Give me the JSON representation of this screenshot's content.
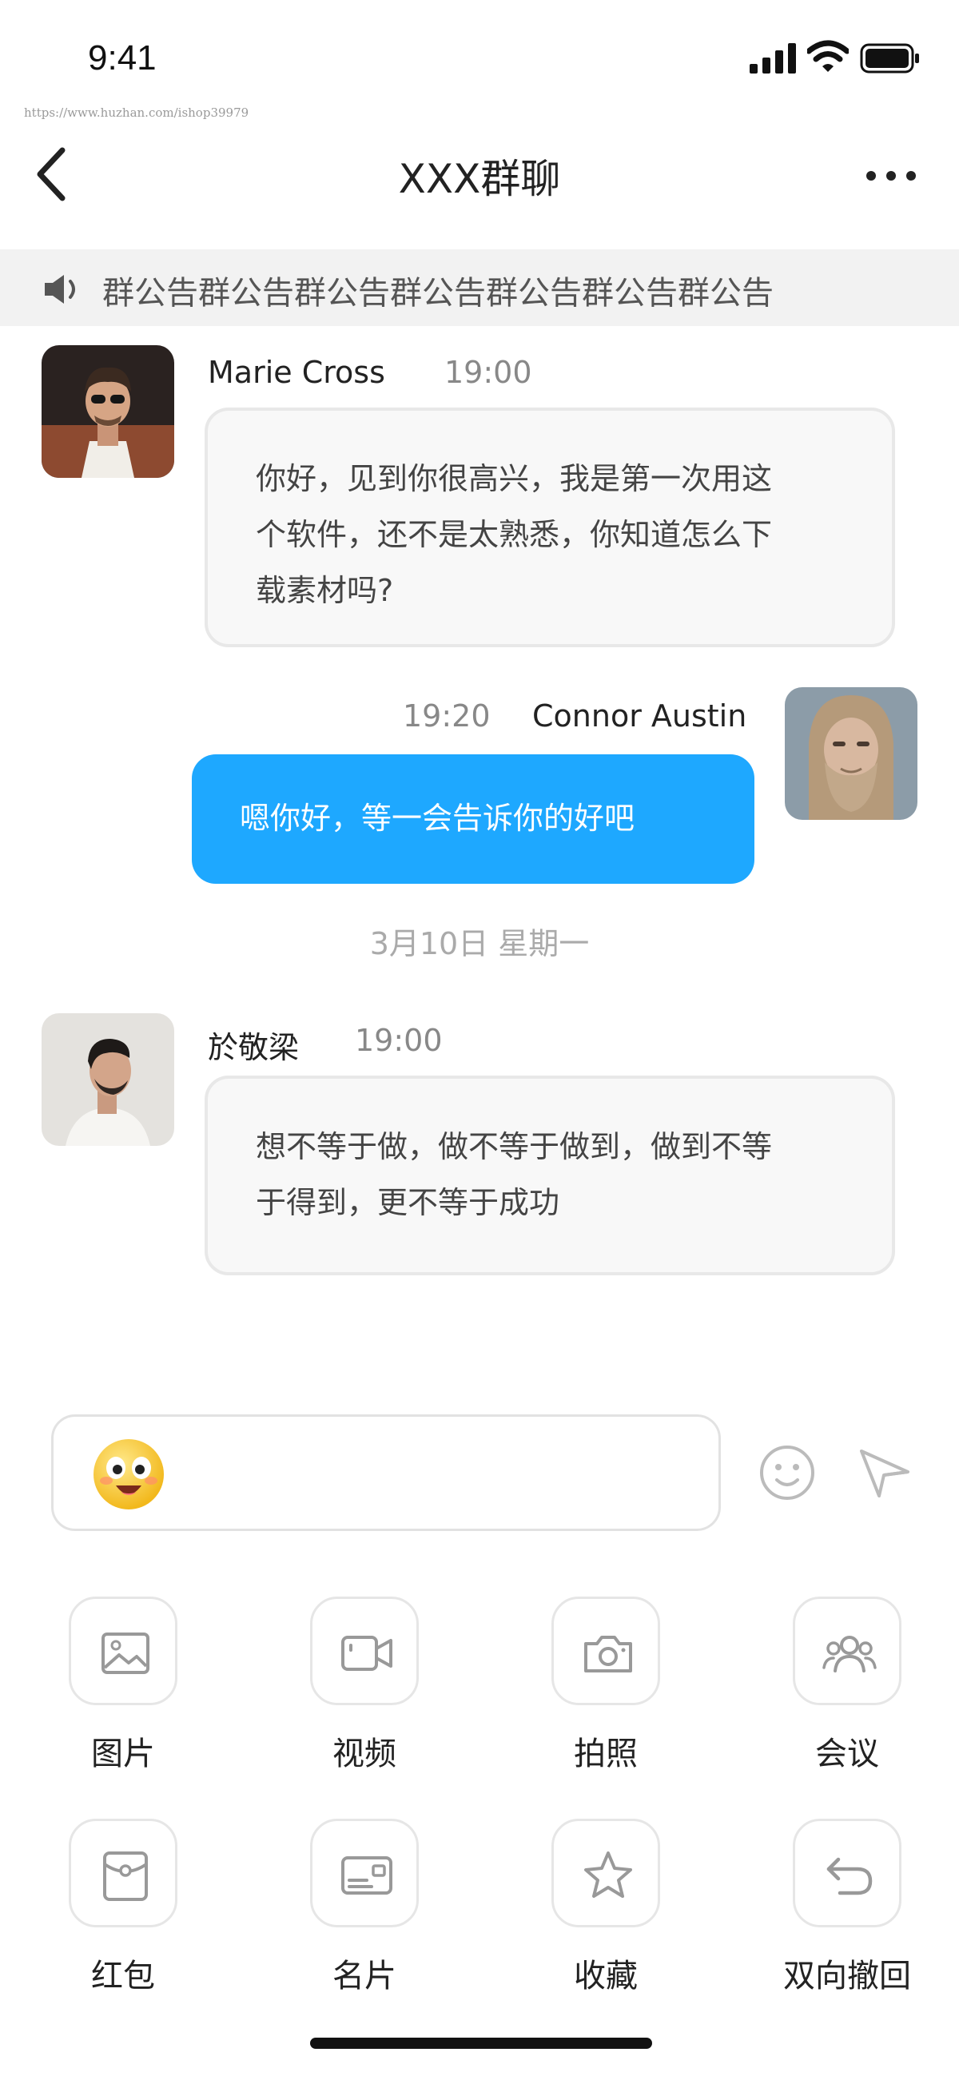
{
  "status_bar": {
    "time": "9:41",
    "signal_icon": "signal-icon",
    "wifi_icon": "wifi-icon",
    "battery_icon": "battery-icon"
  },
  "watermark": "https://www.huzhan.com/ishop39979",
  "nav": {
    "title": "XXX群聊",
    "back_icon": "chevron-left-icon",
    "more_icon": "more-icon"
  },
  "announcement": {
    "icon": "speaker-icon",
    "text": "群公告群公告群公告群公告群公告群公告群公告"
  },
  "messages": [
    {
      "sender": "Marie Cross",
      "time": "19:00",
      "text_lines": [
        "你好，见到你很高兴，我是第一次用这",
        "个软件，还不是太熟悉，你知道怎么下",
        "载素材吗?"
      ]
    },
    {
      "sender": "Connor Austin",
      "time": "19:20",
      "text": "嗯你好，等一会告诉你的好吧"
    },
    {
      "sender": "於敬梁",
      "time": "19:00",
      "text_lines": [
        "想不等于做，做不等于做到，做到不等",
        "于得到，更不等于成功"
      ]
    }
  ],
  "date_divider": "3月10日  星期一",
  "input": {
    "emoji_icon": "emoji-sticker-icon",
    "smile_icon": "smile-icon",
    "send_icon": "send-icon"
  },
  "tools": [
    {
      "label": "图片",
      "icon": "image-icon"
    },
    {
      "label": "视频",
      "icon": "video-icon"
    },
    {
      "label": "拍照",
      "icon": "camera-icon"
    },
    {
      "label": "会议",
      "icon": "meeting-icon"
    },
    {
      "label": "红包",
      "icon": "red-packet-icon"
    },
    {
      "label": "名片",
      "icon": "card-icon"
    },
    {
      "label": "收藏",
      "icon": "star-icon"
    },
    {
      "label": "双向撤回",
      "icon": "undo-icon"
    }
  ],
  "colors": {
    "accent": "#1ea8ff",
    "bubble_in": "#f8f8f8",
    "announce_bg": "#f2f2f2"
  }
}
